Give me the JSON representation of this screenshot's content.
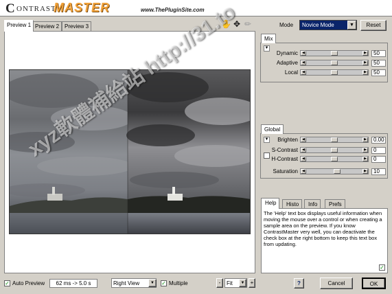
{
  "header": {
    "logo_c": "C",
    "logo_ontrast": "ONTRAST",
    "logo_master": "MASTER",
    "site_url": "www.ThePluginSite.com"
  },
  "preview_tabs": [
    "Preview 1",
    "Preview 2",
    "Preview 3"
  ],
  "tools": {
    "hand_icon": "hand-icon",
    "move_icon": "move-icon",
    "eyedropper_icon": "eyedropper-icon"
  },
  "mode": {
    "label": "Mode",
    "value": "Novice Mode",
    "reset_label": "Reset"
  },
  "mix": {
    "title": "Mix",
    "sliders": [
      {
        "label": "Dynamic",
        "value": "50",
        "level": 0.5
      },
      {
        "label": "Adaptive",
        "value": "50",
        "level": 0.5
      },
      {
        "label": "Local",
        "value": "50",
        "level": 0.5
      }
    ]
  },
  "global": {
    "title": "Global",
    "brighten": {
      "label": "Brighten",
      "value": "0.00",
      "level": 0.5
    },
    "s_contrast": {
      "label": "S-Contrast",
      "value": "0",
      "level": 0.5
    },
    "h_contrast": {
      "label": "H-Contrast",
      "value": "0",
      "level": 0.5
    },
    "saturation": {
      "label": "Saturation",
      "value": "10",
      "level": 0.55
    }
  },
  "help_tabs": [
    "Help",
    "Histo",
    "Info",
    "Prefs"
  ],
  "help_text": "The 'Help' text box displays useful information when moving the mouse over a control or when creating a sample area on the preview. If you know ContrastMaster very well, you can deactivate the check box at the right bottom to keep this text box from updating.",
  "bottom": {
    "auto_preview_label": "Auto Preview",
    "timing": "62 ms -> 5.0 s",
    "view_value": "Right View",
    "multiple_label": "Multiple",
    "zoom_minus": "-",
    "zoom_value": "Fit",
    "zoom_plus": "+",
    "help_label": "?",
    "cancel_label": "Cancel",
    "ok_label": "OK"
  },
  "watermark": "xyz軟體補給站 http://31.to",
  "colors": {
    "face": "#d4d0c8",
    "selection": "#0a246a",
    "logo_orange": "#f1a23a"
  }
}
